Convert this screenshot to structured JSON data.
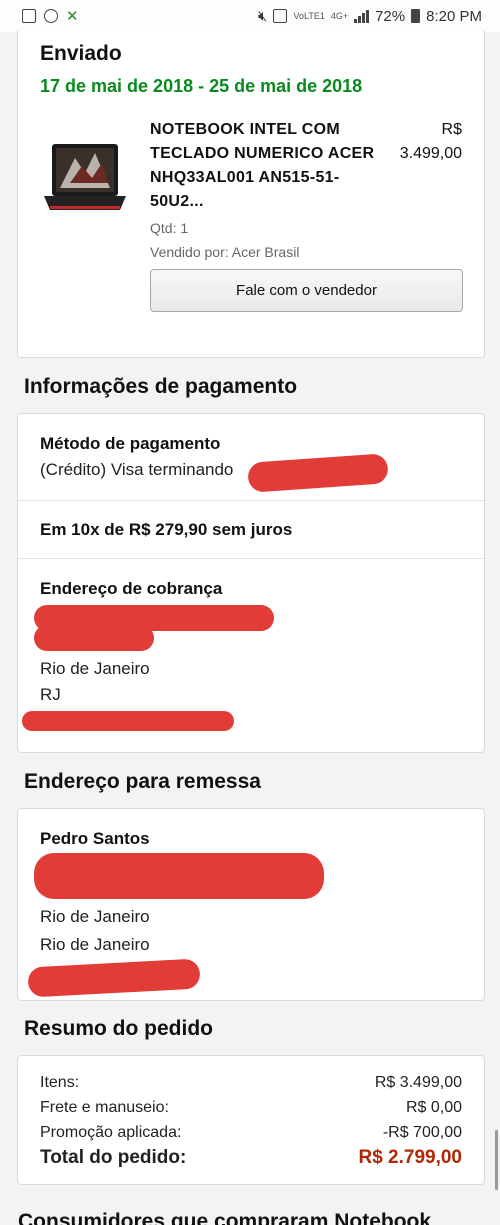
{
  "status_bar": {
    "network_label": "VoLTE1",
    "network_type": "4G+",
    "battery": "72%",
    "time": "8:20 PM"
  },
  "shipped": {
    "title": "Enviado",
    "dates": "17 de mai de 2018 - 25 de mai de 2018",
    "product_name": "NOTEBOOK INTEL COM TECLADO NUMERICO ACER NHQ33AL001 AN515-51-50U2...",
    "price_currency": "R$",
    "price_value": "3.499,00",
    "quantity": "Qtd: 1",
    "seller": "Vendido por: Acer Brasil",
    "contact_button": "Fale com o vendedor"
  },
  "payment": {
    "title": "Informações de pagamento",
    "method_label": "Método de pagamento",
    "method_value": "(Crédito) Visa terminando",
    "installments": "Em 10x de R$ 279,90 sem juros",
    "billing_label": "Endereço de cobrança",
    "billing_city": "Rio de Janeiro",
    "billing_state": "RJ"
  },
  "shipping": {
    "title": "Endereço para remessa",
    "name": "Pedro Santos",
    "city": "Rio de Janeiro",
    "state": "Rio de Janeiro"
  },
  "summary": {
    "title": "Resumo do pedido",
    "items_label": "Itens:",
    "items_value": "R$ 3.499,00",
    "shipping_label": "Frete e manuseio:",
    "shipping_value": "R$ 0,00",
    "promo_label": "Promoção aplicada:",
    "promo_value": "-R$ 700,00",
    "total_label": "Total do pedido:",
    "total_value": "R$ 2.799,00"
  },
  "next_section_partial": "Consumidores que compraram Notebook",
  "colors": {
    "dates_green": "#0a8a1e",
    "total_red": "#b12704",
    "redaction": "#e23c38"
  }
}
